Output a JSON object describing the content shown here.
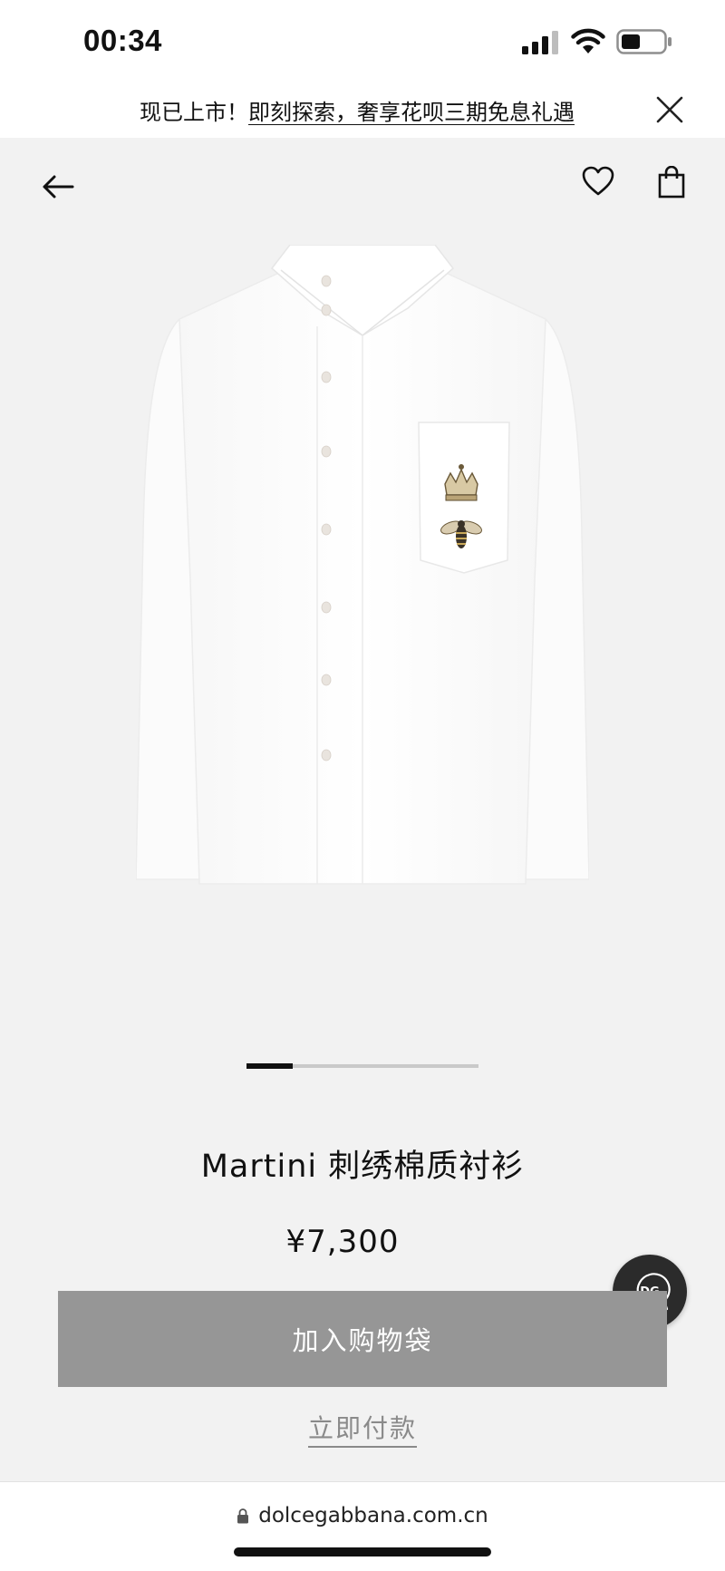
{
  "status_bar": {
    "time": "00:34"
  },
  "announcement": {
    "lead": "现已上市！",
    "link": "即刻探索，奢享花呗三期免息礼遇"
  },
  "product": {
    "title": "Martini 刺绣棉质衬衫",
    "price": "¥7,300",
    "image_alt": "white cotton shirt with crown and bee embroidery",
    "carousel": {
      "current_index": 1,
      "total": 5,
      "progress_fraction": 0.2
    }
  },
  "actions": {
    "add_to_bag": "加入购物袋",
    "buy_now": "立即付款"
  },
  "browser": {
    "url": "dolcegabbana.com.cn"
  },
  "icons": {
    "back": "arrow-left-icon",
    "wishlist": "heart-icon",
    "bag": "shopping-bag-icon",
    "close": "close-icon",
    "chat": "dg-chat-icon",
    "lock": "lock-icon"
  },
  "colors": {
    "background": "#f2f2f2",
    "button_disabled": "#969696",
    "chat_button": "#2b2b2b",
    "text": "#111111"
  }
}
